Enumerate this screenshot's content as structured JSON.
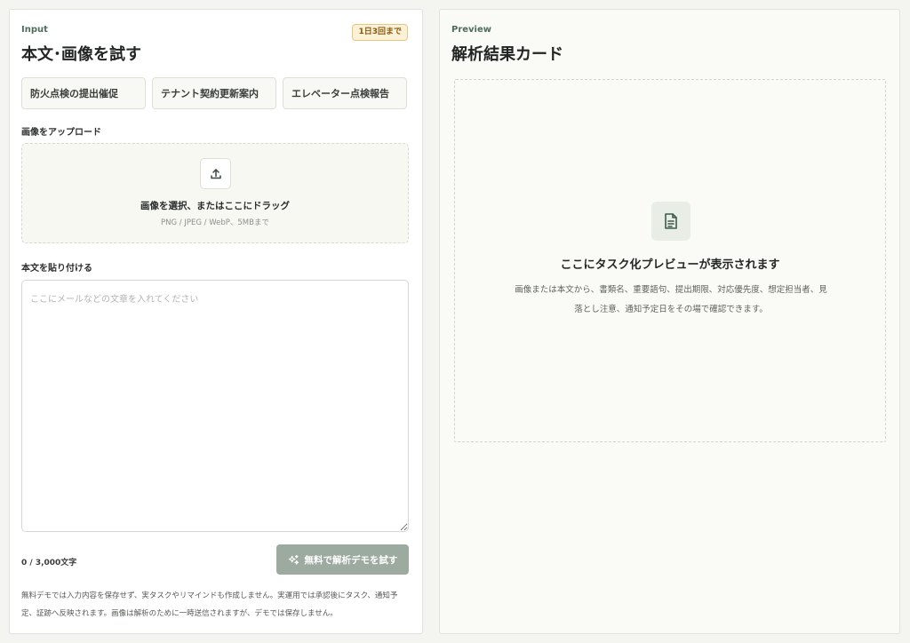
{
  "input_panel": {
    "eyebrow": "Input",
    "title": "本文･画像を試す",
    "limit_badge": "1日3回まで",
    "samples": [
      {
        "label": "防火点検の提出催促"
      },
      {
        "label": "テナント契約更新案内"
      },
      {
        "label": "エレベーター点検報告"
      }
    ],
    "upload": {
      "label": "画像をアップロード",
      "main_text": "画像を選択、またはここにドラッグ",
      "sub_text": "PNG / JPEG / WebP、5MBまで",
      "icon": "upload-icon"
    },
    "body": {
      "label": "本文を貼り付ける",
      "placeholder": "ここにメールなどの文章を入れてください",
      "value": ""
    },
    "counter": "0 / 3,000文字",
    "submit_label": "無料で解析デモを試す",
    "submit_icon": "sparkles-icon",
    "note": "無料デモでは入力内容を保存せず、実タスクやリマインドも作成しません。実運用では承認後にタスク、通知予定、証跡へ反映されます。画像は解析のために一時送信されますが、デモでは保存しません。"
  },
  "preview_panel": {
    "eyebrow": "Preview",
    "title": "解析結果カード",
    "empty_icon": "document-icon",
    "empty_title": "ここにタスク化プレビューが表示されます",
    "empty_desc": "画像または本文から、書類名、重要語句、提出期限、対応優先度、想定担当者、見落とし注意、通知予定日をその場で確認できます。"
  },
  "colors": {
    "accent_green": "#4f6b59",
    "button_disabled": "#9caaa0",
    "badge_bg": "#fbf1d7",
    "badge_text": "#8a5a12"
  }
}
